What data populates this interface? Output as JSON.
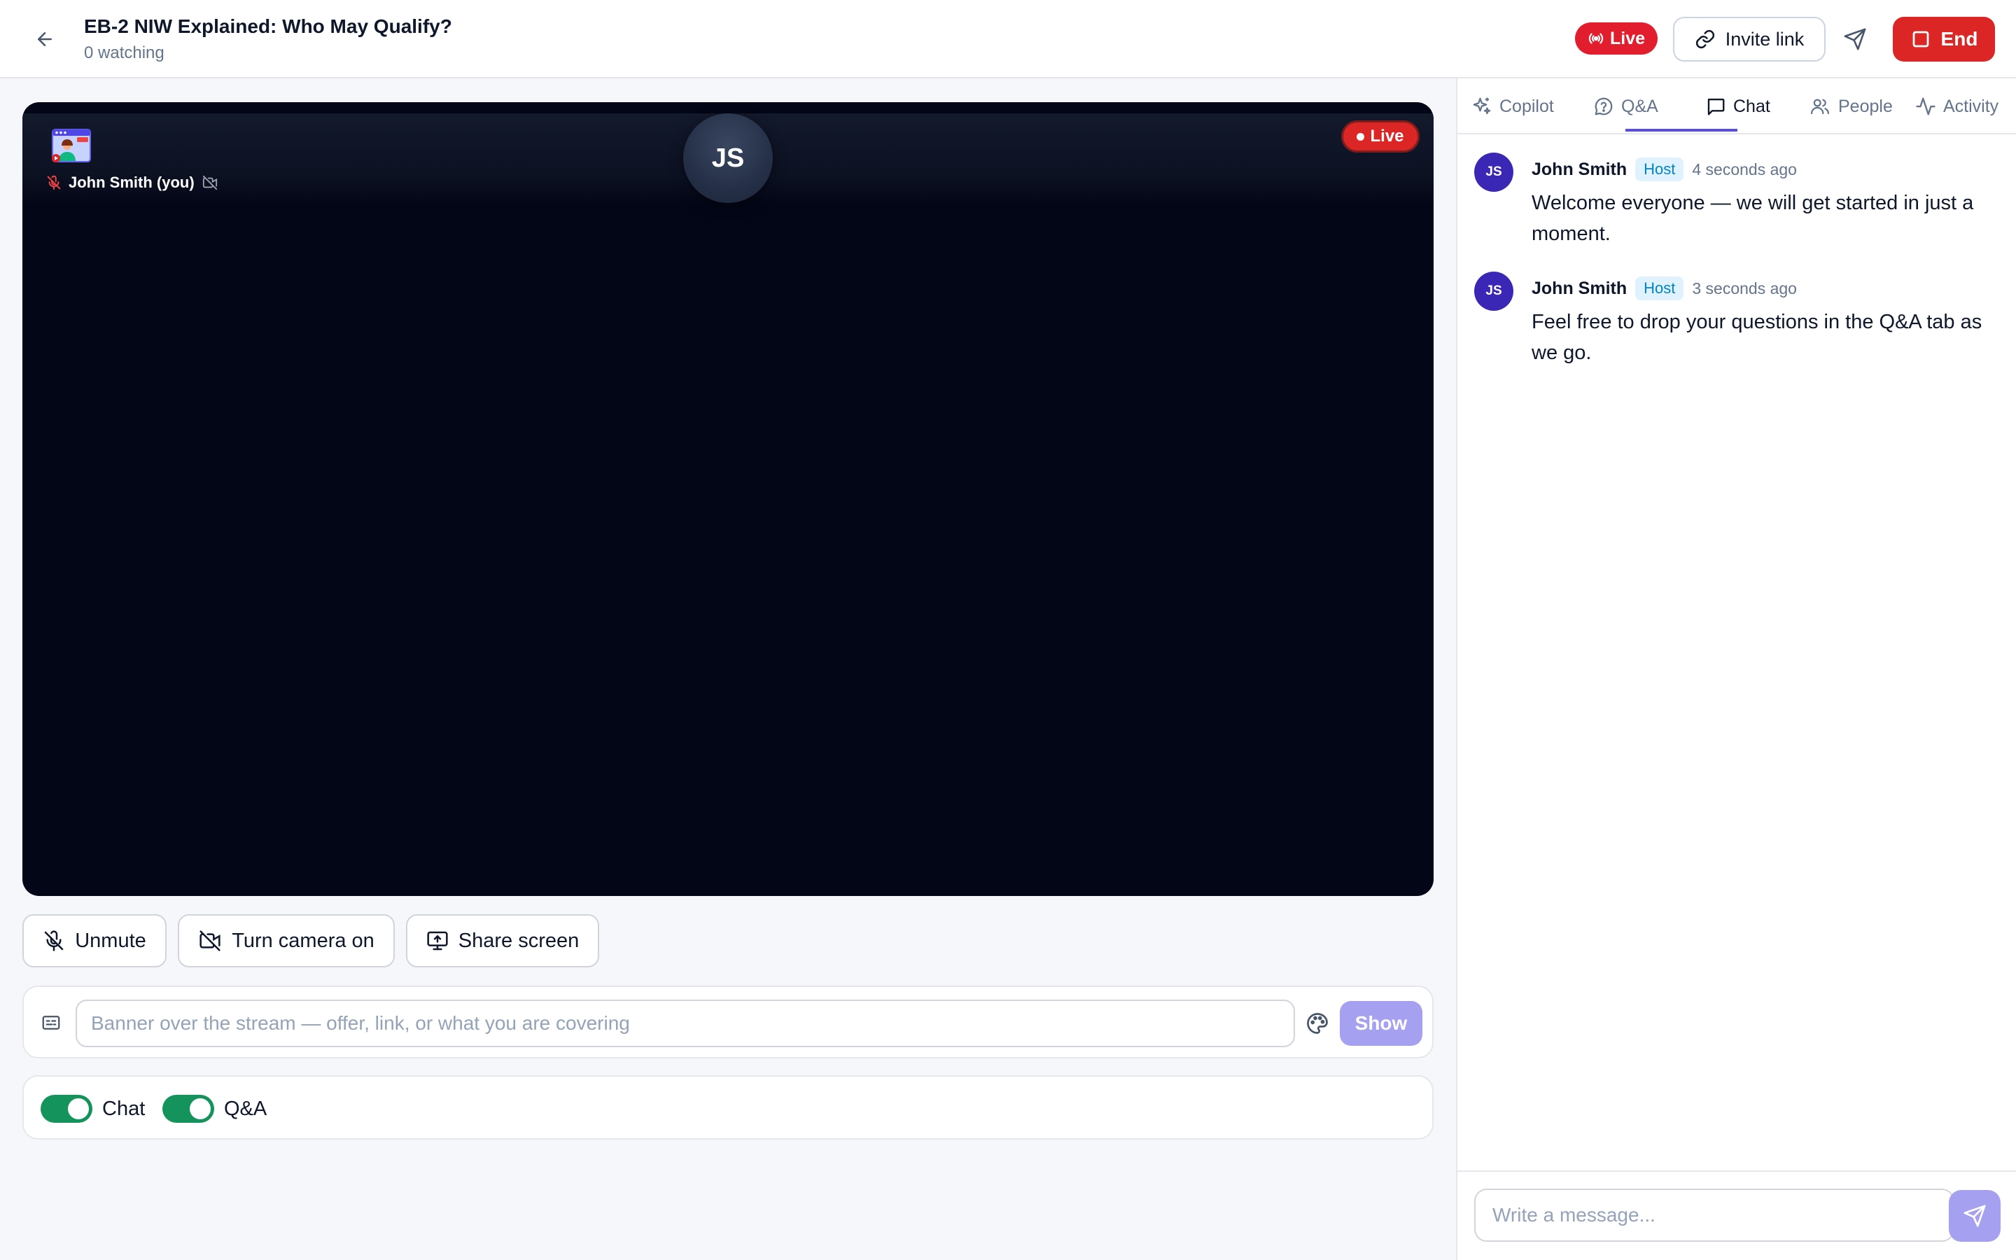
{
  "header": {
    "back_icon": "arrow-left-icon",
    "title": "EB-2 NIW Explained: Who May Qualify?",
    "subtitle": "0 watching",
    "live_label": "Live",
    "invite_label": "Invite link",
    "end_label": "End"
  },
  "stage": {
    "participant_name": "John Smith (you)",
    "avatar_initials": "JS",
    "live_label": "Live"
  },
  "controls": {
    "unmute_label": "Unmute",
    "camera_label": "Turn camera on",
    "share_label": "Share screen"
  },
  "banner": {
    "placeholder": "Banner over the stream — offer, link, or what you are covering",
    "show_label": "Show"
  },
  "toggles": [
    {
      "label": "Chat",
      "on": true
    },
    {
      "label": "Q&A",
      "on": true
    }
  ],
  "panel": {
    "tabs": [
      {
        "label": "Copilot",
        "icon": "sparkles-icon",
        "active": false
      },
      {
        "label": "Q&A",
        "icon": "question-bubble-icon",
        "active": false
      },
      {
        "label": "Chat",
        "icon": "chat-bubble-icon",
        "active": true
      },
      {
        "label": "People",
        "icon": "people-icon",
        "active": false
      },
      {
        "label": "Activity",
        "icon": "activity-icon",
        "active": false
      }
    ],
    "messages": [
      {
        "initials": "JS",
        "name": "John Smith",
        "badge": "Host",
        "time": "4 seconds ago",
        "text": "Welcome everyone — we will get started in just a moment."
      },
      {
        "initials": "JS",
        "name": "John Smith",
        "badge": "Host",
        "time": "3 seconds ago",
        "text": "Feel free to drop your questions in the Q&A tab as we go."
      }
    ],
    "composer_placeholder": "Write a message..."
  },
  "colors": {
    "live_red": "#dc2626",
    "accent_purple": "#5b4fd6",
    "toggle_green": "#15935c",
    "avatar_indigo": "#3b27b5"
  }
}
